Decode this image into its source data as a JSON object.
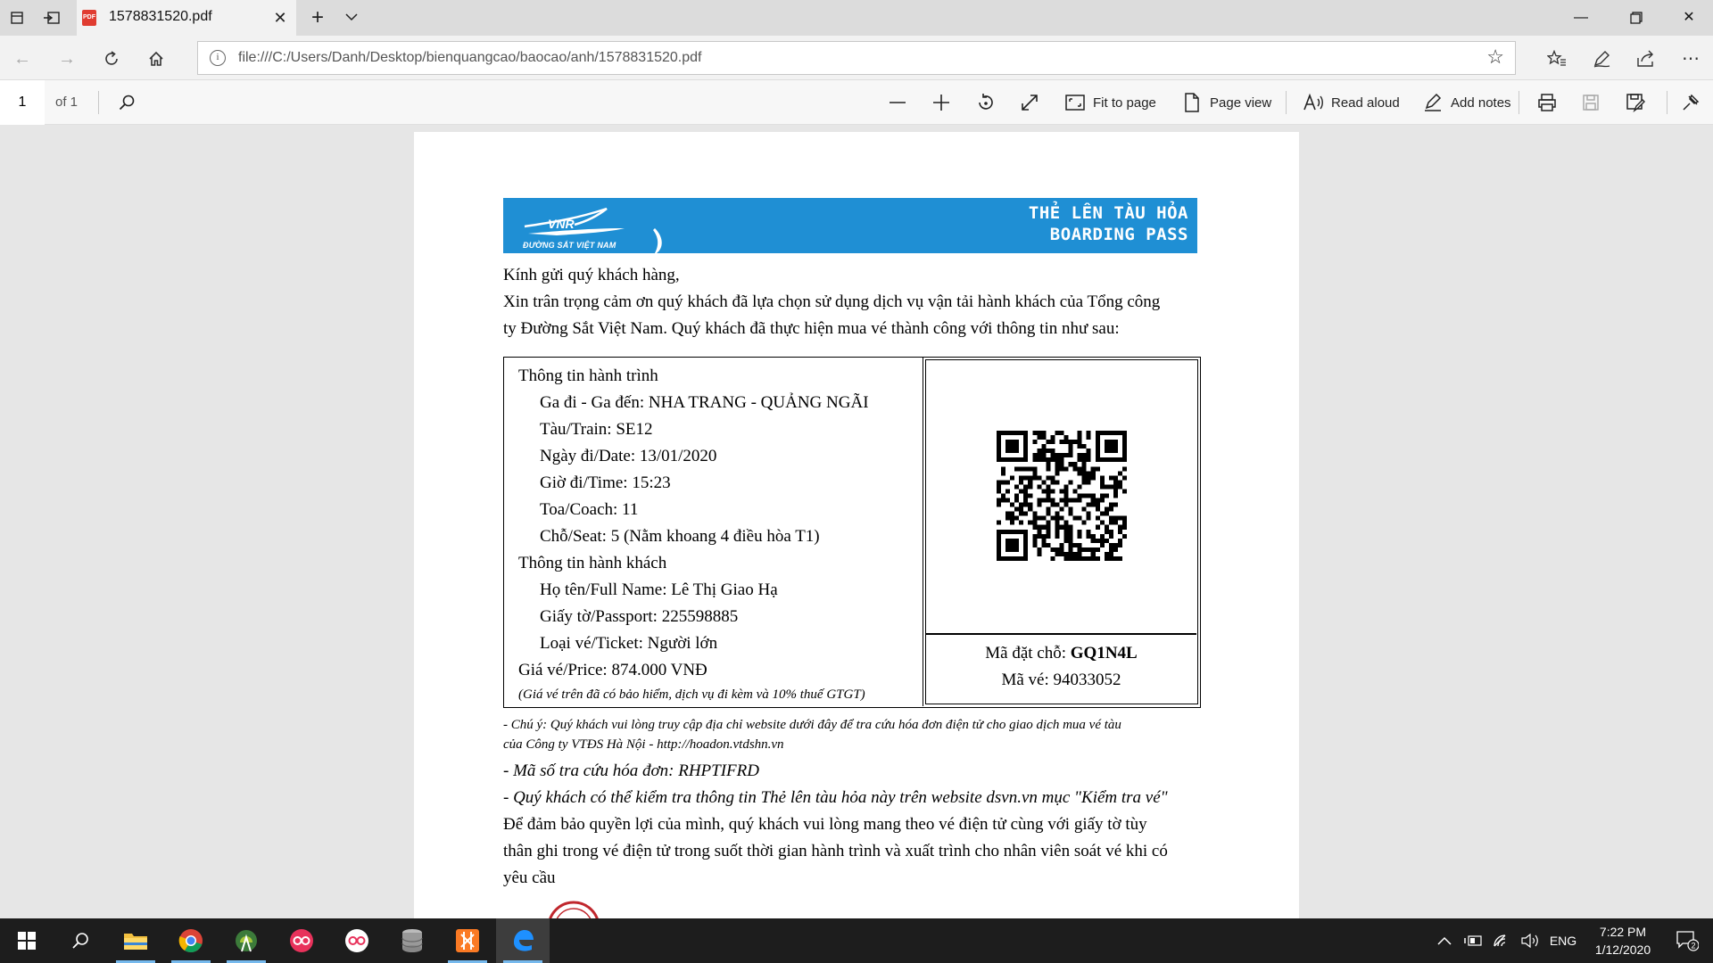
{
  "browser": {
    "tab_title": "1578831520.pdf",
    "tab_icon_text": "PDF",
    "url": "file:///C:/Users/Danh/Desktop/bienquangcao/baocao/anh/1578831520.pdf"
  },
  "pdf_toolbar": {
    "page_number": "1",
    "page_of": "of 1",
    "fit_to_page": "Fit to page",
    "page_view": "Page view",
    "read_aloud": "Read aloud",
    "add_notes": "Add notes"
  },
  "document": {
    "banner": {
      "brand": "ĐƯỜNG SẮT VIỆT NAM",
      "logo_text": "VNR",
      "title_vi": "THẺ LÊN TÀU HỎA",
      "title_en": "BOARDING PASS"
    },
    "greeting": "Kính gửi quý khách hàng,",
    "intro_line1": "Xin trân trọng cảm ơn quý khách đã lựa chọn sử dụng dịch vụ vận tải hành khách của Tổng công",
    "intro_line2": "ty Đường Sắt Việt Nam. Quý khách đã thực hiện mua vé thành công với thông tin như sau:",
    "trip": {
      "heading": "Thông tin hành trình",
      "route": "Ga đi - Ga đến: NHA TRANG - QUẢNG NGÃI",
      "train": "Tàu/Train: SE12",
      "date": "Ngày đi/Date: 13/01/2020",
      "time": "Giờ đi/Time: 15:23",
      "coach": "Toa/Coach: 11",
      "seat": "Chỗ/Seat: 5 (Nằm khoang 4 điều hòa T1)"
    },
    "passenger": {
      "heading": "Thông tin hành khách",
      "name": "Họ tên/Full Name: Lê Thị Giao Hạ",
      "passport": "Giấy tờ/Passport: 225598885",
      "ticket_type": "Loại vé/Ticket: Người lớn"
    },
    "price": "Giá vé/Price: 874.000 VNĐ",
    "price_note": "(Giá vé trên đã có bảo hiểm, dịch vụ đi kèm và 10% thuế GTGT)",
    "booking_code_label": "Mã đặt chỗ: ",
    "booking_code": "GQ1N4L",
    "ticket_no": "Mã vé: 94033052",
    "note_line1": "- Chú ý: Quý khách vui lòng truy cập địa chỉ website dưới đây để tra cứu hóa đơn điện tử cho giao dịch mua vé tàu",
    "note_line2": "của Công ty VTĐS Hà Nội - http://hoadon.vtdshn.vn",
    "invoice_code": "- Mã số tra cứu hóa đơn: RHPTIFRD",
    "check_info": "- Quý khách có thể kiểm tra thông tin Thẻ lên tàu hỏa này trên website dsvn.vn mục \"Kiểm tra vé\"",
    "reminder_line1": "Để đảm bảo quyền lợi của mình, quý khách vui lòng mang theo vé điện tử cùng với giấy tờ tùy",
    "reminder_line2": "thân ghi trong vé điện tử trong suốt thời gian hành trình và xuất trình cho nhân viên soát vé khi có",
    "reminder_line3": "yêu cầu"
  },
  "taskbar": {
    "language": "ENG",
    "time": "7:22 PM",
    "date": "1/12/2020",
    "notification_count": "2"
  },
  "colors": {
    "banner_blue": "#1f8fd4",
    "taskbar": "#1d1d1d",
    "edge_blue": "#1e90ff"
  }
}
